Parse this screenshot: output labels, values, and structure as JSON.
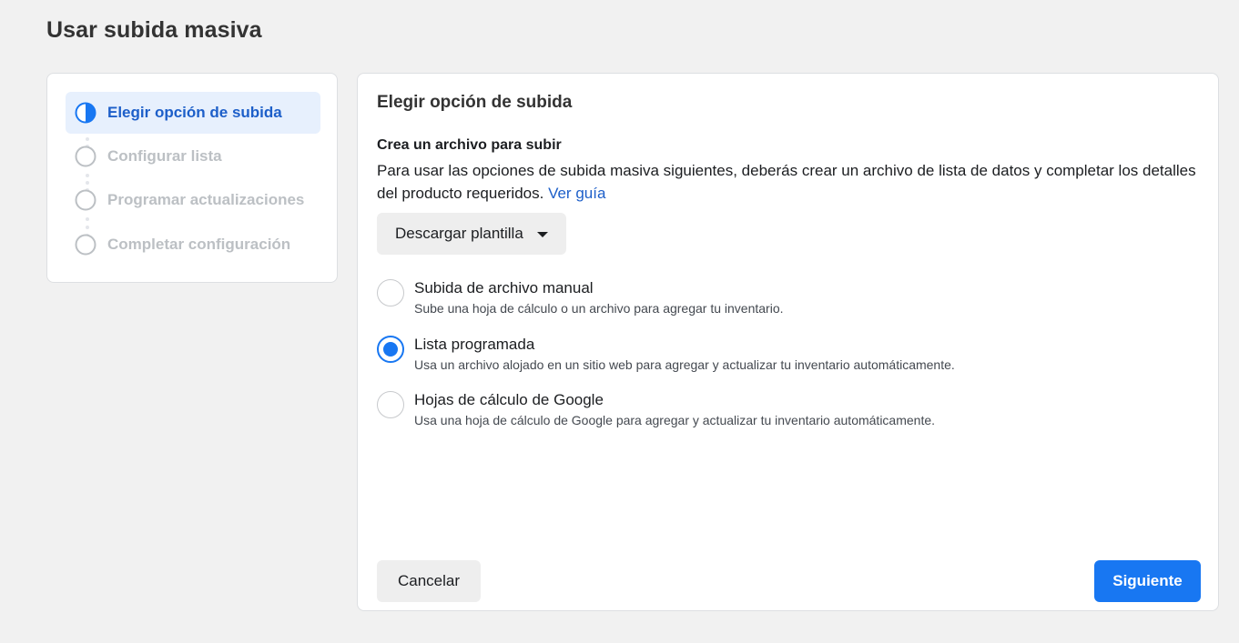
{
  "page": {
    "title": "Usar subida masiva"
  },
  "stepper": {
    "steps": [
      {
        "label": "Elegir opción de subida",
        "state": "active",
        "icon": "half-filled-circle-icon"
      },
      {
        "label": "Configurar lista",
        "state": "pending",
        "icon": "empty-circle-icon"
      },
      {
        "label": "Programar actualizaciones",
        "state": "pending",
        "icon": "empty-circle-icon"
      },
      {
        "label": "Completar configuración",
        "state": "pending",
        "icon": "empty-circle-icon"
      }
    ]
  },
  "main": {
    "title": "Elegir opción de subida",
    "section_heading": "Crea un archivo para subir",
    "section_desc": "Para usar las opciones de subida masiva siguientes, deberás crear un archivo de lista de datos y completar los detalles del producto requeridos.",
    "guide_link": "Ver guía",
    "download_button": "Descargar plantilla",
    "options": [
      {
        "title": "Subida de archivo manual",
        "desc": "Sube una hoja de cálculo o un archivo para agregar tu inventario.",
        "checked": false
      },
      {
        "title": "Lista programada",
        "desc": "Usa un archivo alojado en un sitio web para agregar y actualizar tu inventario automáticamente.",
        "checked": true
      },
      {
        "title": "Hojas de cálculo de Google",
        "desc": "Usa una hoja de cálculo de Google para agregar y actualizar tu inventario automáticamente.",
        "checked": false
      }
    ],
    "cancel_button": "Cancelar",
    "next_button": "Siguiente"
  },
  "colors": {
    "accent": "#1877f2",
    "active_step_bg": "#e7f0fd",
    "active_step_text": "#1d5fc9",
    "inactive_step": "#bcc0c4",
    "page_bg": "#f1f1f1"
  }
}
